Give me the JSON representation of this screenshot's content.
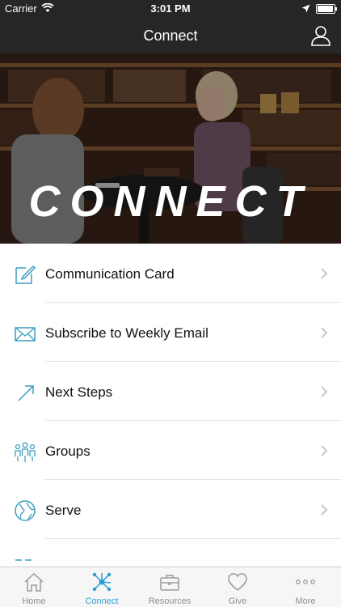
{
  "status_bar": {
    "carrier": "Carrier",
    "time": "3:01 PM",
    "battery_level": 0.95
  },
  "nav": {
    "title": "Connect",
    "profile_icon": "profile-icon"
  },
  "hero": {
    "text": "CONNECT"
  },
  "menu": {
    "items": [
      {
        "label": "Communication Card",
        "icon": "edit-icon"
      },
      {
        "label": "Subscribe to Weekly Email",
        "icon": "envelope-icon"
      },
      {
        "label": "Next Steps",
        "icon": "arrow-up-right-icon"
      },
      {
        "label": "Groups",
        "icon": "people-icon"
      },
      {
        "label": "Serve",
        "icon": "globe-icon"
      }
    ]
  },
  "tab_bar": {
    "tabs": [
      {
        "label": "Home",
        "icon": "home-icon"
      },
      {
        "label": "Connect",
        "icon": "network-icon",
        "active": true
      },
      {
        "label": "Resources",
        "icon": "briefcase-icon"
      },
      {
        "label": "Give",
        "icon": "heart-icon"
      },
      {
        "label": "More",
        "icon": "more-icon"
      }
    ]
  },
  "colors": {
    "accent": "#2a9fd6",
    "bar_dark": "#262626",
    "icon_teal": "#3a9fc2"
  }
}
